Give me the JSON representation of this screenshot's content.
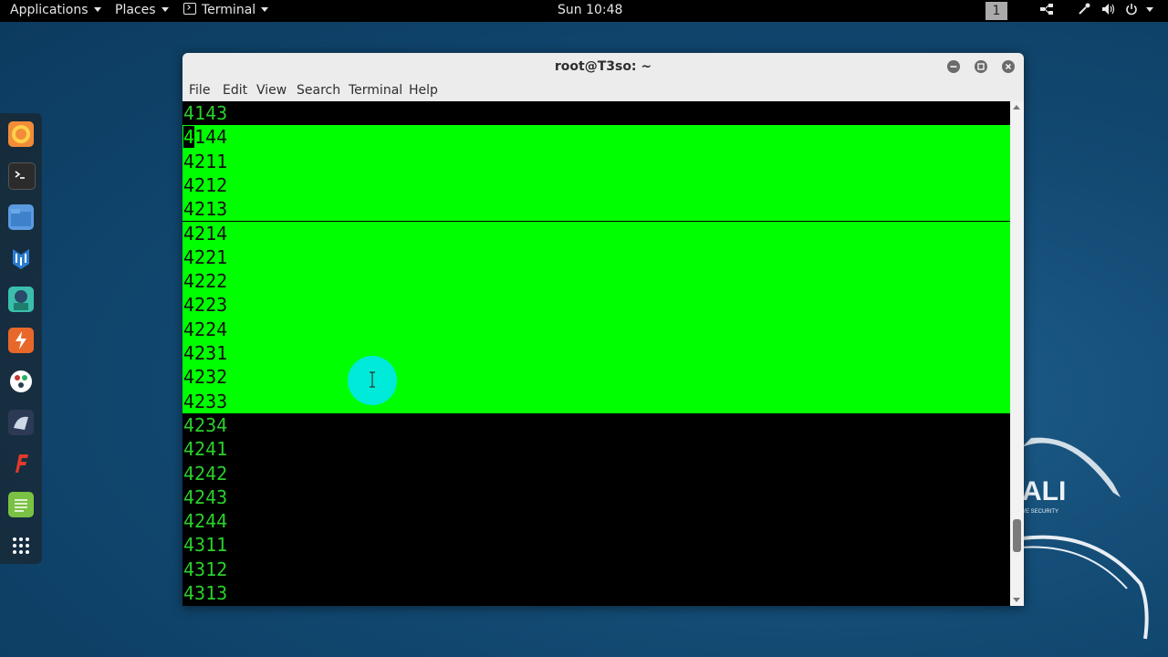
{
  "top_bar": {
    "applications": "Applications",
    "places": "Places",
    "terminal_menu": "Terminal",
    "clock": "Sun 10:48",
    "workspace": "1"
  },
  "dock": {
    "items": [
      {
        "name": "firefox-icon",
        "color": "#f07a2b"
      },
      {
        "name": "terminal-icon",
        "color": "#2b2b2b"
      },
      {
        "name": "files-icon",
        "color": "#4b8fd6"
      },
      {
        "name": "metasploit-icon",
        "color": "#2a7bd1"
      },
      {
        "name": "armitage-icon",
        "color": "#3bbfad"
      },
      {
        "name": "burpsuite-icon",
        "color": "#e8682a"
      },
      {
        "name": "maltego-icon",
        "color": "#ffffff"
      },
      {
        "name": "beef-icon",
        "color": "#3b4a66"
      },
      {
        "name": "faraday-icon",
        "color": "#e23a2a"
      },
      {
        "name": "leafpad-icon",
        "color": "#7bc143"
      },
      {
        "name": "show-apps-icon",
        "color": "#ffffff"
      }
    ]
  },
  "window": {
    "title": "root@T3so: ~",
    "menu": [
      "File",
      "Edit",
      "View",
      "Search",
      "Terminal",
      "Help"
    ]
  },
  "terminal": {
    "lines": [
      {
        "text": "4143",
        "selected": false
      },
      {
        "text": "4144",
        "selected": true
      },
      {
        "text": "4211",
        "selected": true
      },
      {
        "text": "4212",
        "selected": true
      },
      {
        "text": "4213",
        "selected": true
      },
      {
        "text": "4214",
        "selected": true
      },
      {
        "text": "4221",
        "selected": true
      },
      {
        "text": "4222",
        "selected": true
      },
      {
        "text": "4223",
        "selected": true
      },
      {
        "text": "4224",
        "selected": true
      },
      {
        "text": "4231",
        "selected": true
      },
      {
        "text": "4232",
        "selected": true
      },
      {
        "text": "4233",
        "selected": true
      },
      {
        "text": "4234",
        "selected": false
      },
      {
        "text": "4241",
        "selected": false
      },
      {
        "text": "4242",
        "selected": false
      },
      {
        "text": "4243",
        "selected": false
      },
      {
        "text": "4244",
        "selected": false
      },
      {
        "text": "4311",
        "selected": false
      },
      {
        "text": "4312",
        "selected": false
      },
      {
        "text": "4313",
        "selected": false
      }
    ]
  },
  "desktop": {
    "kali_text": "ALI",
    "kali_sub": "VE SECURITY"
  },
  "colors": {
    "terminal_fg": "#2ad12a",
    "selection_bg": "#00ff00",
    "click_marker": "#00e6ff"
  }
}
